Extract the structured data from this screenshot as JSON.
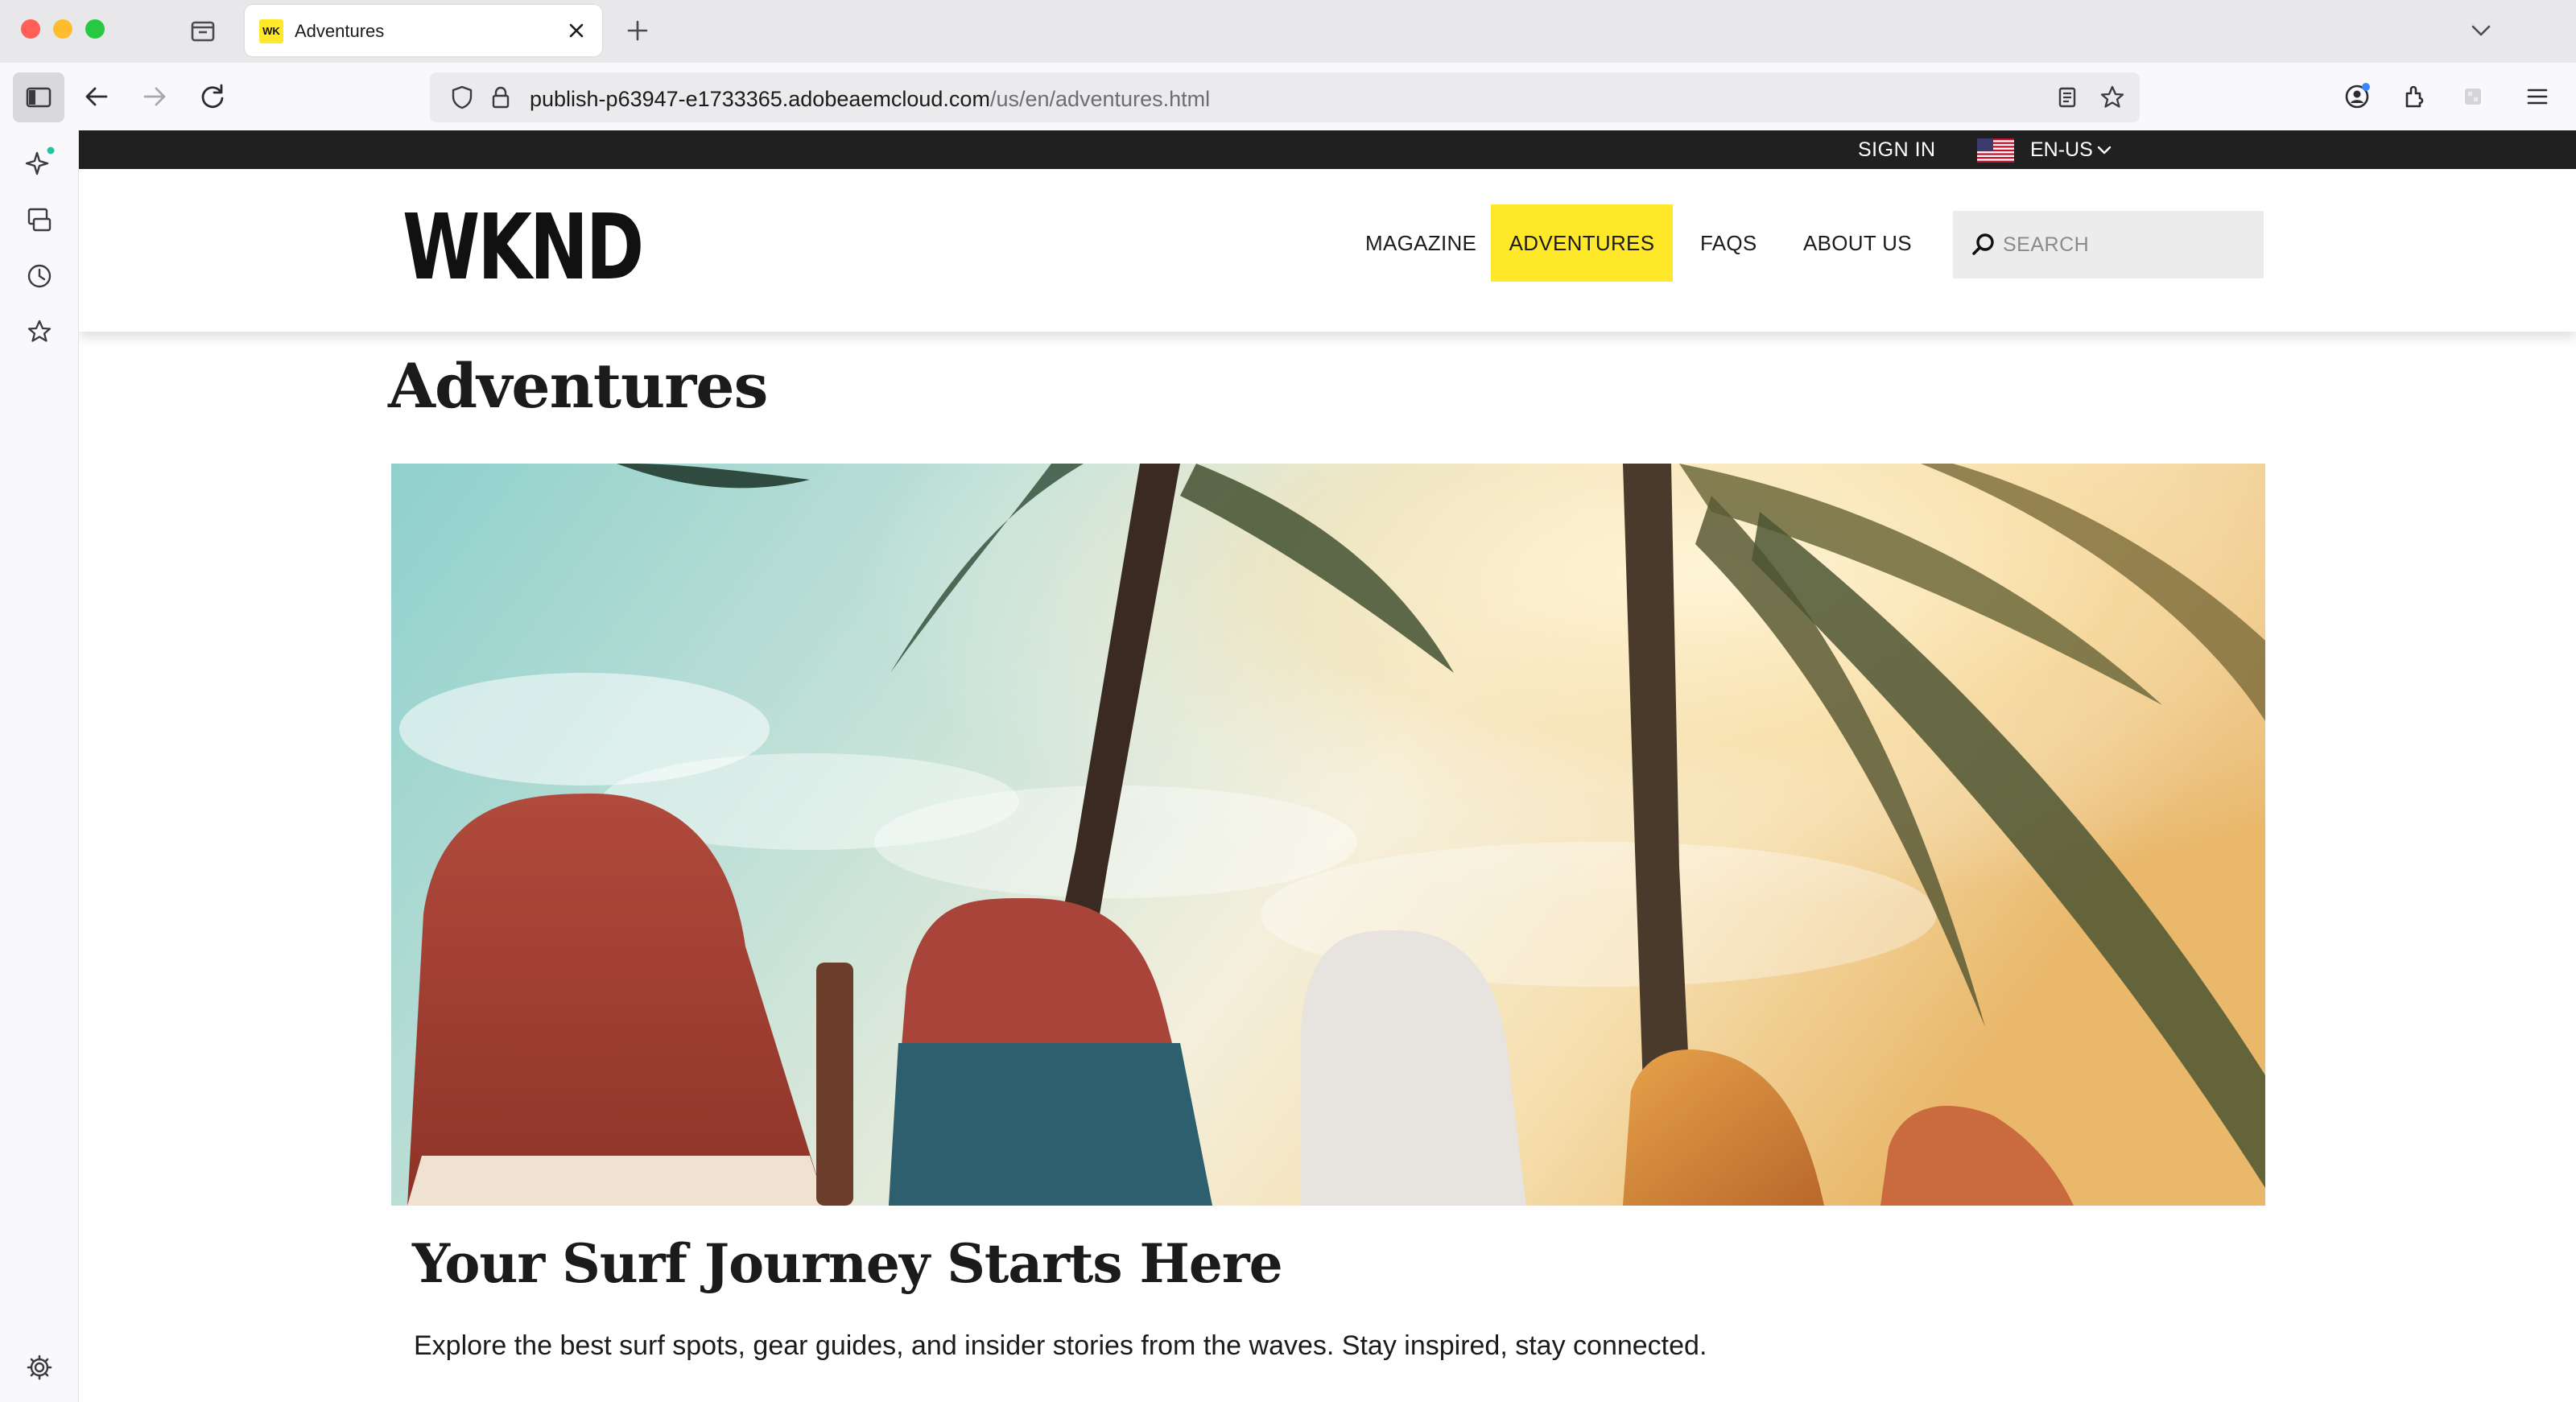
{
  "browser": {
    "tab": {
      "favicon_text": "WK",
      "title": "Adventures"
    },
    "url": {
      "host": "publish-p63947-e1733365.adobeaemcloud.com",
      "path": "/us/en/adventures.html"
    }
  },
  "site": {
    "topbar": {
      "sign_in": "SIGN IN",
      "language": "EN-US"
    },
    "logo": "WKND",
    "nav": [
      {
        "label": "MAGAZINE",
        "active": false
      },
      {
        "label": "ADVENTURES",
        "active": true
      },
      {
        "label": "FAQS",
        "active": false
      },
      {
        "label": "ABOUT US",
        "active": false
      }
    ],
    "search": {
      "placeholder": "SEARCH",
      "value": ""
    },
    "accent_color": "#ffe82a"
  },
  "main": {
    "page_title": "Adventures",
    "hero": {
      "title": "Your Surf Journey Starts Here",
      "description": "Explore the best surf spots, gear guides, and insider stories from the waves. Stay inspired, stay connected."
    }
  }
}
